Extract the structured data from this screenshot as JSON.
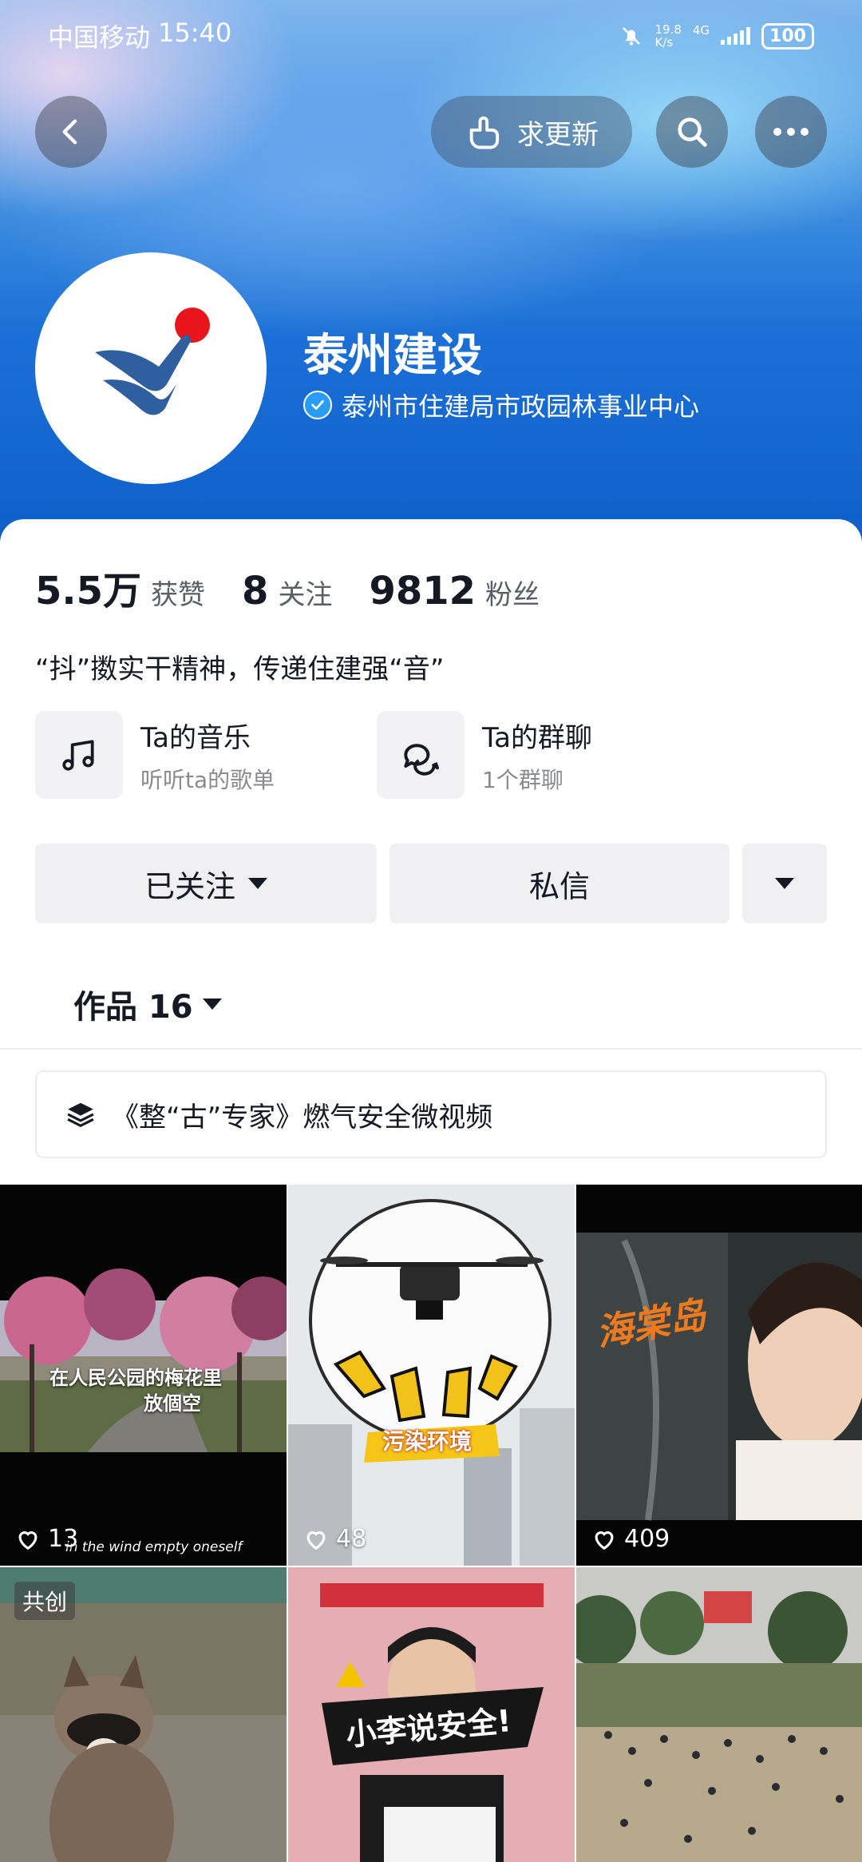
{
  "status_bar": {
    "carrier": "中国移动",
    "time": "15:40",
    "net_speed_value": "19.8",
    "net_speed_unit": "K/s",
    "network_type": "4G",
    "battery": "100"
  },
  "header": {
    "update_button_label": "求更新"
  },
  "profile": {
    "name": "泰州建设",
    "verified_label": "泰州市住建局市政园林事业中心"
  },
  "stats": [
    {
      "value": "5.5万",
      "label": "获赞"
    },
    {
      "value": "8",
      "label": "关注"
    },
    {
      "value": "9812",
      "label": "粉丝"
    }
  ],
  "bio": "“抖”擞实干精神，传递住建强“音”",
  "features": [
    {
      "title": "Ta的音乐",
      "subtitle": "听听ta的歌单",
      "icon": "music-note-icon"
    },
    {
      "title": "Ta的群聊",
      "subtitle": "1个群聊",
      "icon": "chat-bubbles-icon"
    }
  ],
  "actions": {
    "follow_label": "已关注",
    "message_label": "私信"
  },
  "tabs": {
    "works_label": "作品 16"
  },
  "collection": {
    "title": "《整“古”专家》燃气安全微视频"
  },
  "videos": [
    {
      "likes": "13",
      "overlay_text": "在人民公园的梅花里",
      "overlay_text2": "放個空",
      "caption": "in the wind empty oneself"
    },
    {
      "likes": "48",
      "overlay_text": "污染环境"
    },
    {
      "likes": "409",
      "overlay_text": "海棠岛"
    },
    {
      "badge": "共创"
    },
    {
      "overlay_text": "小李说安全!"
    },
    {}
  ],
  "colors": {
    "accent_blue": "#1b6fd6",
    "verify_blue": "#2a9cf5",
    "logo_red": "#e8161c",
    "logo_blue": "#2f5f9e"
  }
}
